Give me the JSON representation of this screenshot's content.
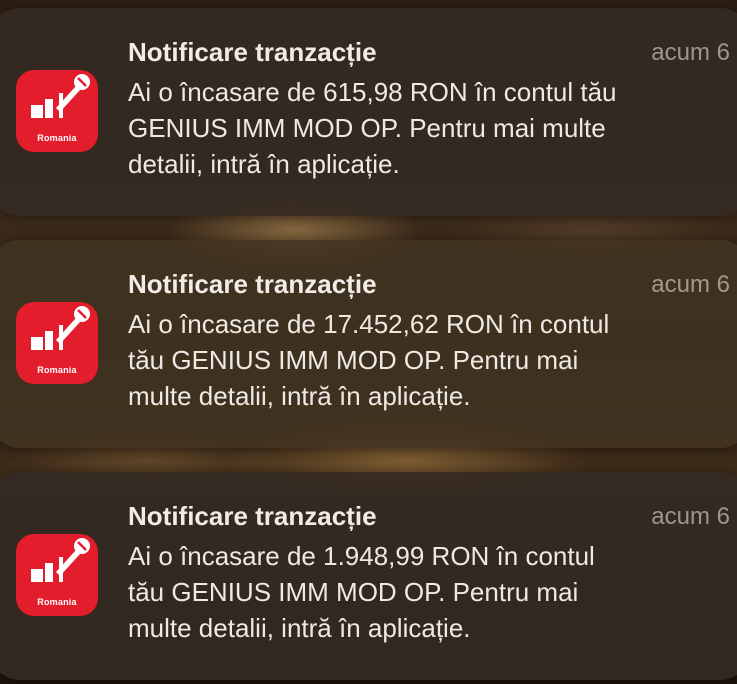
{
  "notifications": [
    {
      "app_icon": "raiffeisen-app-icon",
      "icon_brand": "Romania",
      "title": "Notificare tranzacție",
      "time": "acum 6",
      "body_lines": [
        "Ai o încasare de 615,98 RON în contul tău",
        "GENIUS IMM MOD OP. Pentru mai multe",
        "detalii, intră în aplicație."
      ]
    },
    {
      "app_icon": "raiffeisen-app-icon",
      "icon_brand": "Romania",
      "title": "Notificare tranzacție",
      "time": "acum 6",
      "body_lines": [
        "Ai o încasare de 17.452,62 RON în contul",
        "tău GENIUS IMM MOD OP. Pentru mai",
        "multe detalii, intră în aplicație."
      ]
    },
    {
      "app_icon": "raiffeisen-app-icon",
      "icon_brand": "Romania",
      "title": "Notificare tranzacție",
      "time": "acum 6",
      "body_lines": [
        "Ai o încasare de 1.948,99 RON în contul",
        "tău GENIUS IMM MOD OP. Pentru mai",
        "multe detalii, intră în aplicație."
      ]
    }
  ],
  "colors": {
    "icon_background": "#e31d2b",
    "card_background": "#3a2e24",
    "text_primary": "#efe9e3",
    "text_secondary": "#a89e94"
  }
}
